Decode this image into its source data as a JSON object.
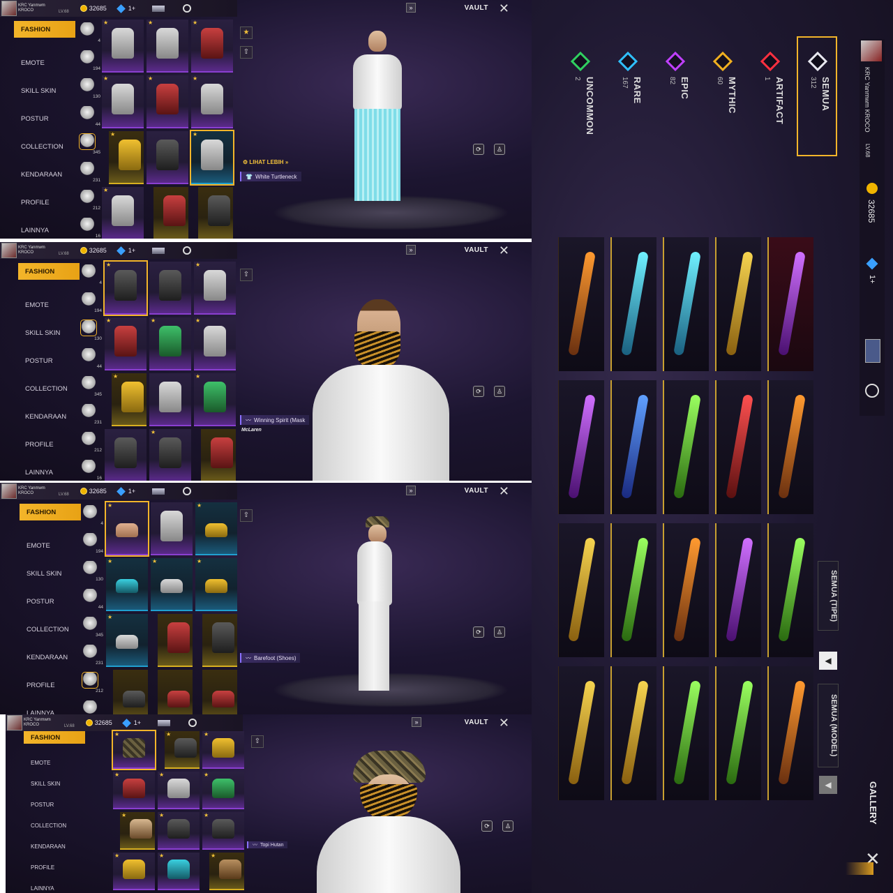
{
  "player": {
    "name_line1": "KRC Yanmwm",
    "name_line2": "KROCO",
    "level": "LV.68",
    "gold": "32685",
    "diamonds": "1+"
  },
  "header": {
    "vault_label": "VAULT"
  },
  "categories": [
    "FASHION",
    "EMOTE",
    "SKILL SKIN",
    "POSTUR",
    "COLLECTION",
    "KENDARAAN",
    "PROFILE",
    "LAINNYA"
  ],
  "sub_counts": [
    "4",
    "194",
    "130",
    "44",
    "345",
    "231",
    "212",
    "16"
  ],
  "panels": [
    {
      "selected_item": "White Turtleneck",
      "more_label": "LIHAT LEBIH"
    },
    {
      "selected_item": "Winning Spirit (Mask",
      "sponsor": "McLaren"
    },
    {
      "selected_item": "Barefoot (Shoes)"
    },
    {
      "selected_item": "Topi Hutan"
    }
  ],
  "gallery": {
    "rarities": [
      {
        "name": "SEMUA",
        "count": "312",
        "color": "#e8e8f0"
      },
      {
        "name": "ARTIFACT",
        "count": "1",
        "color": "#ff3040"
      },
      {
        "name": "MYTHIC",
        "count": "60",
        "color": "#f0b020"
      },
      {
        "name": "EPIC",
        "count": "82",
        "color": "#c040ff"
      },
      {
        "name": "RARE",
        "count": "167",
        "color": "#30c0ff"
      },
      {
        "name": "UNCOMMON",
        "count": "2",
        "color": "#30d060"
      }
    ],
    "rail": {
      "name": "KRC Yanmwm KROCO",
      "level": "LV.68",
      "gold": "32685",
      "diamonds": "1+"
    },
    "filter_type": "SEMUA (TIPE)",
    "filter_model": "SEMUA (MODEL)",
    "title": "GALLERY",
    "weapons": [
      "orange",
      "cyan",
      "cyan",
      "gold",
      "purple",
      "purple",
      "blue",
      "green",
      "red",
      "orange",
      "gold",
      "green",
      "orange",
      "purple",
      "green",
      "gold",
      "gold",
      "green",
      "green",
      "orange"
    ]
  }
}
